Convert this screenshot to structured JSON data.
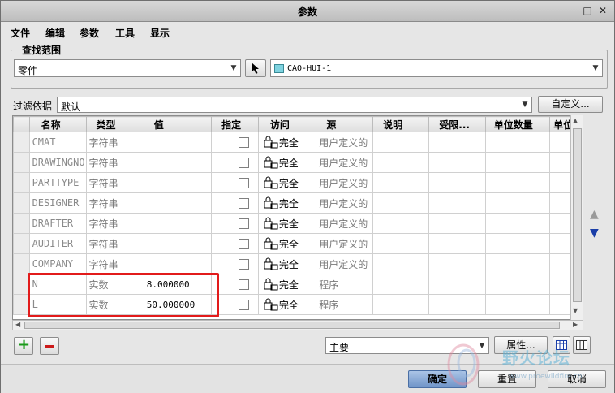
{
  "window": {
    "title": "参数"
  },
  "menu": [
    "文件",
    "编辑",
    "参数",
    "工具",
    "显示"
  ],
  "search_scope": {
    "label": "查找范围",
    "scope_value": "零件",
    "model_value": "CAO-HUI-1"
  },
  "filter": {
    "label": "过滤依据",
    "value": "默认",
    "customize_label": "自定义..."
  },
  "table": {
    "columns": [
      "名称",
      "类型",
      "值",
      "指定",
      "访问",
      "源",
      "说明",
      "受限...",
      "单位数量",
      "单位"
    ],
    "rows": [
      {
        "name": "CMAT",
        "type": "字符串",
        "value": "",
        "access": "完全",
        "source": "用户定义的"
      },
      {
        "name": "DRAWINGNO",
        "type": "字符串",
        "value": "",
        "access": "完全",
        "source": "用户定义的"
      },
      {
        "name": "PARTTYPE",
        "type": "字符串",
        "value": "",
        "access": "完全",
        "source": "用户定义的"
      },
      {
        "name": "DESIGNER",
        "type": "字符串",
        "value": "",
        "access": "完全",
        "source": "用户定义的"
      },
      {
        "name": "DRAFTER",
        "type": "字符串",
        "value": "",
        "access": "完全",
        "source": "用户定义的"
      },
      {
        "name": "AUDITER",
        "type": "字符串",
        "value": "",
        "access": "完全",
        "source": "用户定义的"
      },
      {
        "name": "COMPANY",
        "type": "字符串",
        "value": "",
        "access": "完全",
        "source": "用户定义的"
      },
      {
        "name": "N",
        "type": "实数",
        "value": "8.000000",
        "access": "完全",
        "source": "程序"
      },
      {
        "name": "L",
        "type": "实数",
        "value": "50.000000",
        "access": "完全",
        "source": "程序"
      }
    ]
  },
  "bottom_controls": {
    "main_select": "主要",
    "properties_label": "属性..."
  },
  "dialog_buttons": {
    "ok": "确定",
    "reset": "重置",
    "cancel": "取消"
  },
  "watermark": {
    "text": "野火论坛",
    "url_text": "www.proewildfire.cn"
  },
  "colors": {
    "highlight": "#e21b1b",
    "add_icon": "#1a9a1a",
    "remove_icon": "#cc1a1a",
    "move_arrow": "#1a3ea8",
    "ok_button": "#6f94c8"
  }
}
